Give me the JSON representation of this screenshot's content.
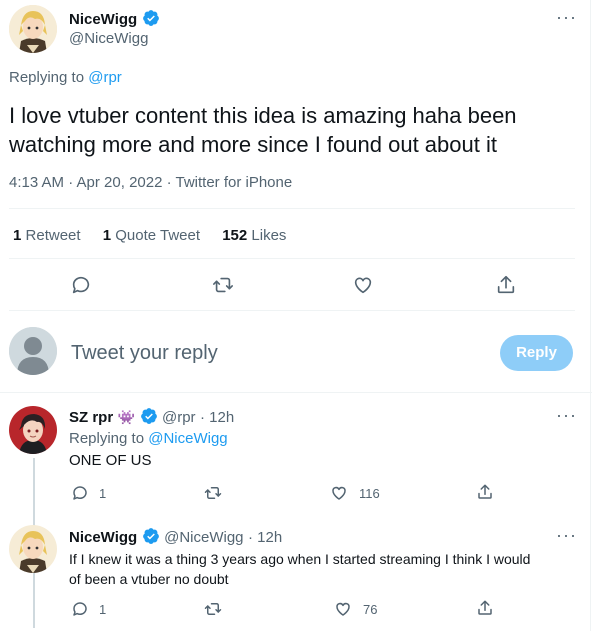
{
  "main_tweet": {
    "name": "NiceWigg",
    "handle": "@NiceWigg",
    "replying_prefix": "Replying to",
    "replying_to": "@rpr",
    "text": "I love vtuber content this idea is amazing haha been watching more and more since I found out about it",
    "timestamp": "4:13 AM · Apr 20, 2022 · Twitter for iPhone",
    "stats": {
      "retweets_count": "1",
      "retweets_label": "Retweet",
      "quote_count": "1",
      "quote_label": "Quote Tweet",
      "likes_count": "152",
      "likes_label": "Likes"
    },
    "actions": [
      "reply-icon",
      "retweet-icon",
      "like-icon",
      "share-icon"
    ]
  },
  "reply_box": {
    "placeholder": "Tweet your reply",
    "button_label": "Reply"
  },
  "replies": [
    {
      "name": "SZ rpr",
      "emoji": "👾",
      "handle": "@rpr",
      "time": "· 12h",
      "replying_prefix": "Replying to",
      "replying_to": "@NiceWigg",
      "text": "ONE OF US",
      "reply_count": "1",
      "retweet_count": "",
      "like_count": "116"
    },
    {
      "name": "NiceWigg",
      "handle": "@NiceWigg",
      "time": "· 12h",
      "text_line1": "If I knew it was a thing 3 years ago when I started streaming I think I would",
      "text_line2": "of been a vtuber no doubt",
      "reply_count": "1",
      "retweet_count": "",
      "like_count": "76"
    }
  ],
  "colors": {
    "accent": "#1d9bf0",
    "reply_button_disabled": "#8ecdf8",
    "secondary_text": "#536471",
    "divider": "#eff3f4"
  }
}
